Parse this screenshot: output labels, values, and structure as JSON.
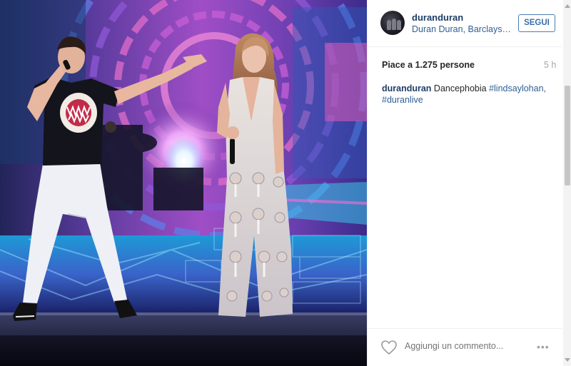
{
  "post": {
    "username": "duranduran",
    "location": "Duran Duran, Barclays…",
    "follow_label": "SEGUI",
    "likes": "Piace a 1.275 persone",
    "time": "5 h",
    "caption": {
      "username": "duranduran",
      "text": " Dancephobia ",
      "tag1": "#lindsaylohan,",
      "tag2": "#duranlive"
    },
    "comment_placeholder": "Aggiungi un commento...",
    "more_label": "•••"
  },
  "colors": {
    "link": "#2f5f94",
    "username": "#1e3d66",
    "follow_border": "#4a7cb3",
    "muted": "#a5a7aa"
  },
  "icons": {
    "like": "heart-outline-icon",
    "more": "more-options-icon"
  }
}
